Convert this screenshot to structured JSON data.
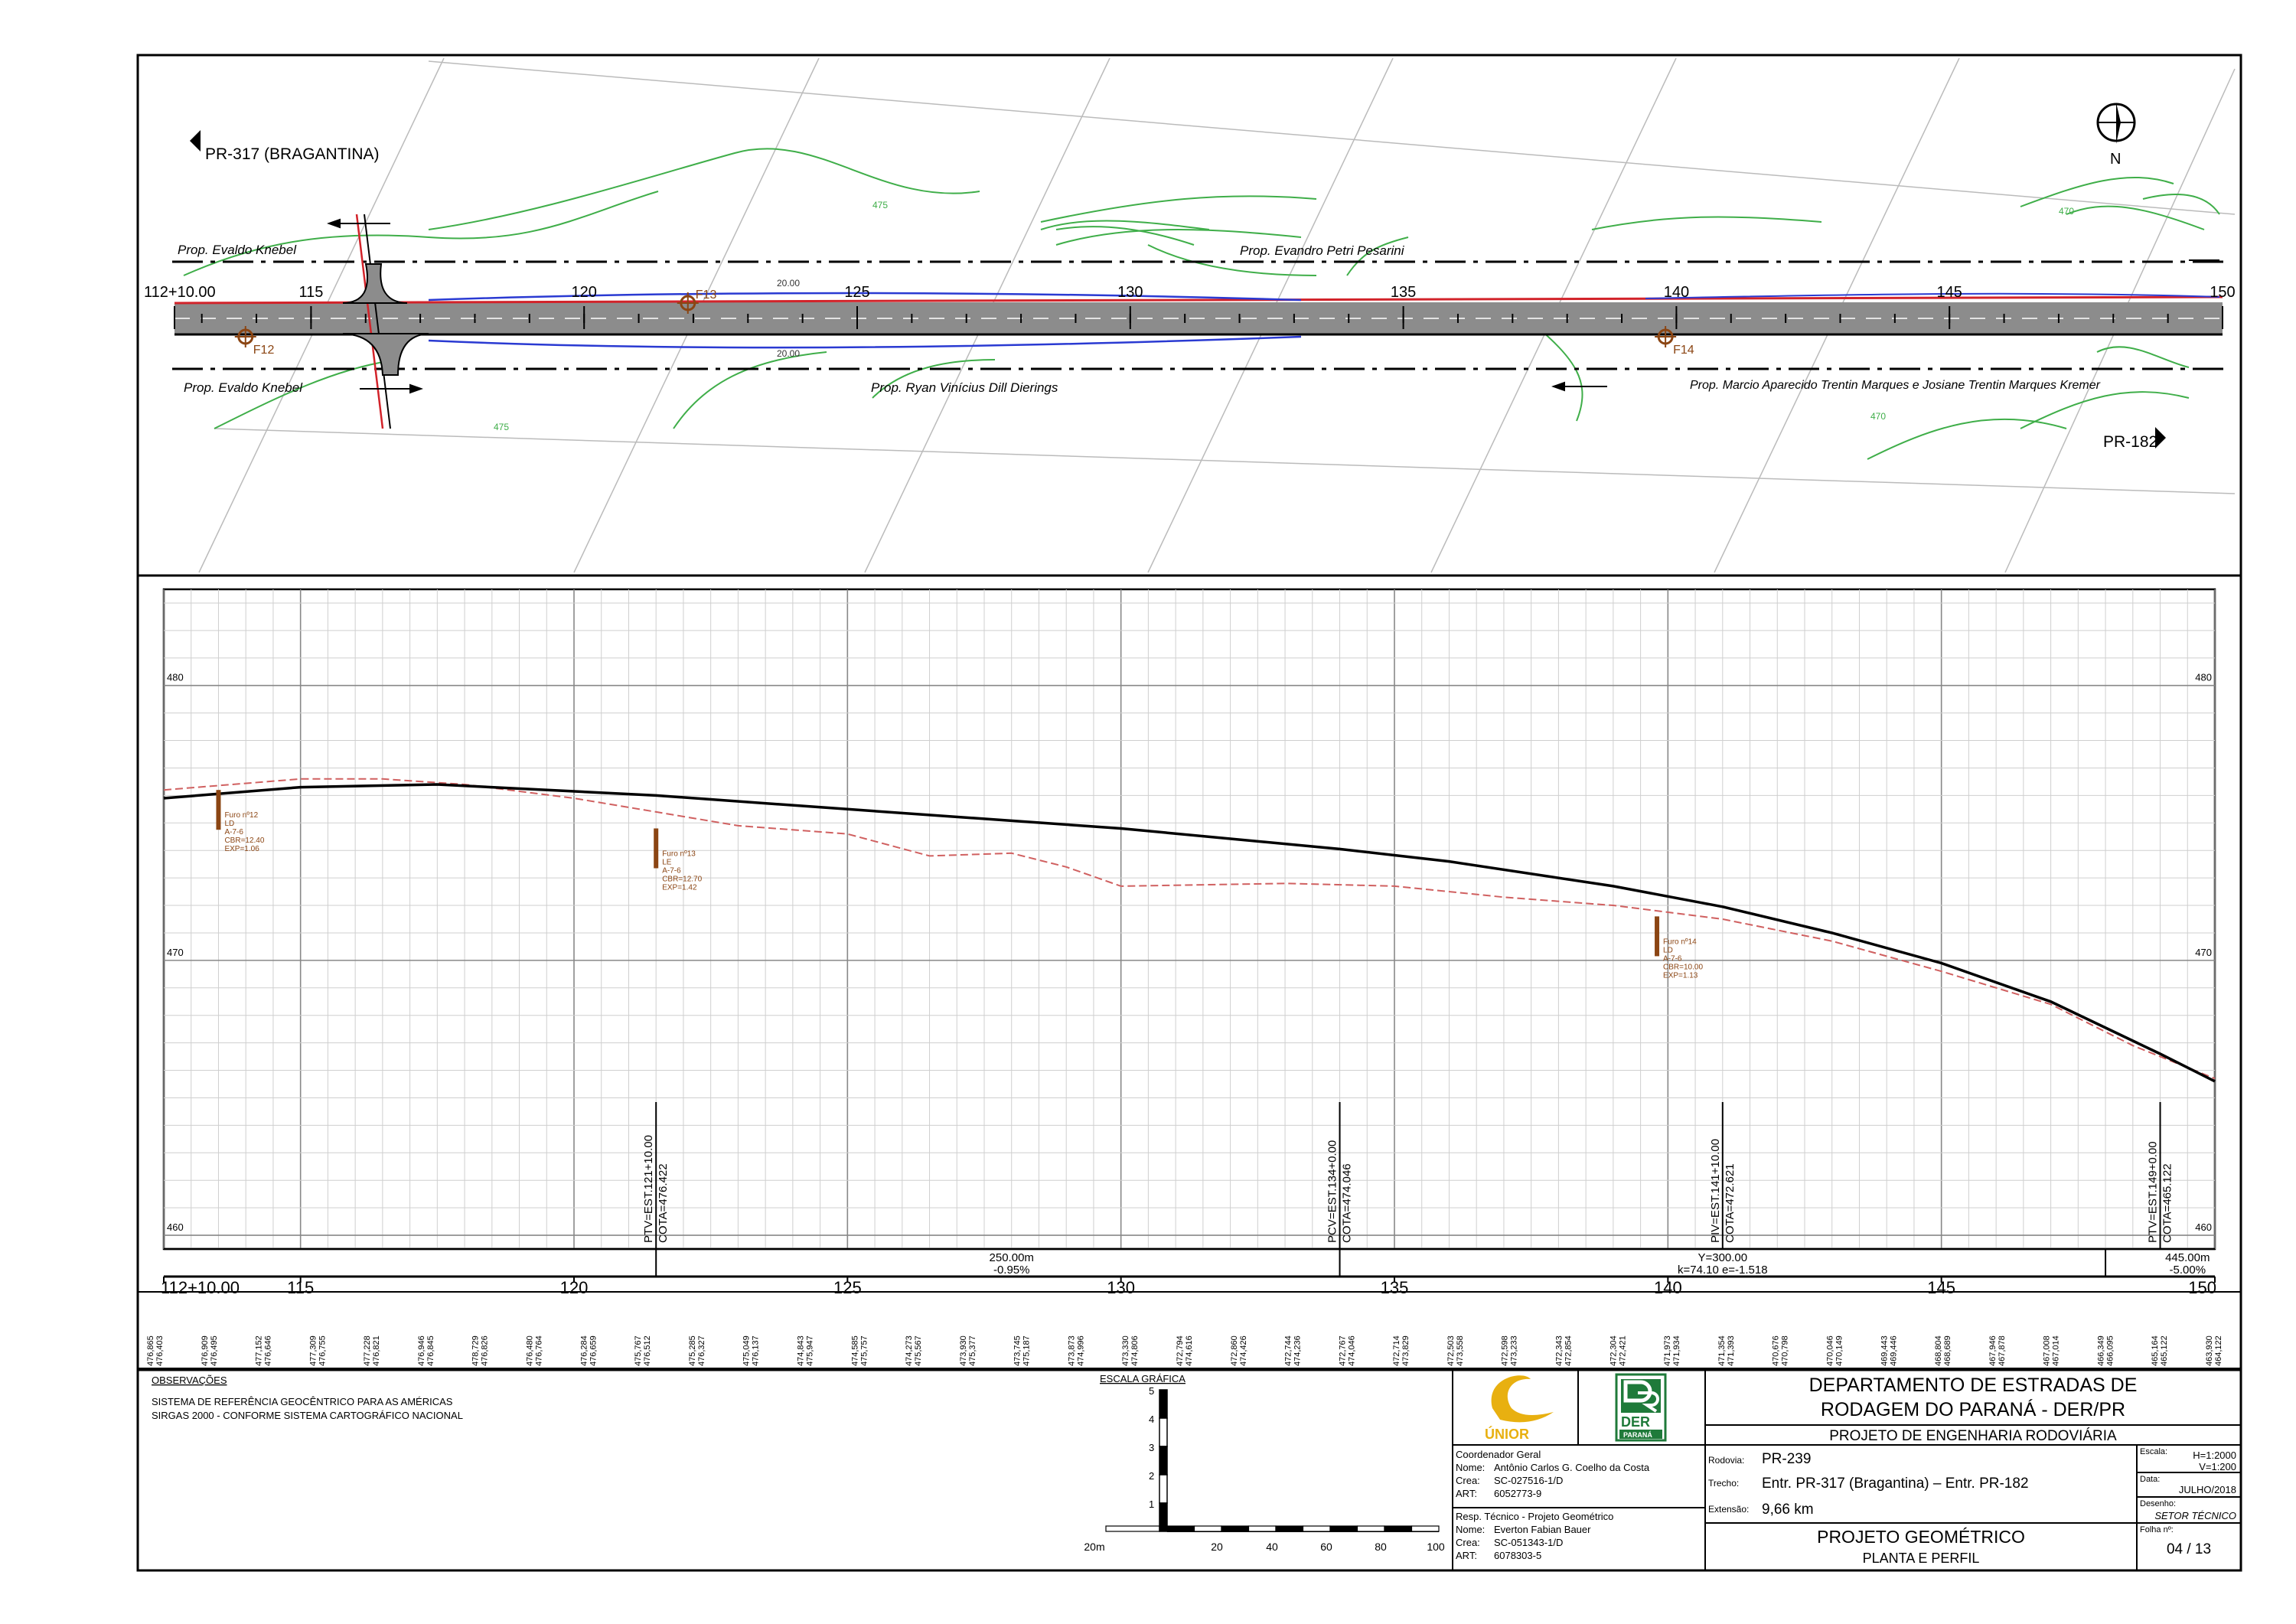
{
  "plan": {
    "road_left": "PR-317 (BRAGANTINA)",
    "road_right": "PR-182",
    "north_label": "N",
    "properties_top": [
      {
        "name": "Prop. Evaldo Knebel"
      },
      {
        "name": "Prop. Evandro Petri Pesarini"
      }
    ],
    "properties_bottom": [
      {
        "name": "Prop. Evaldo Knebel"
      },
      {
        "name": "Prop. Ryan Vinícius Dill Dierings"
      },
      {
        "name": "Prop. Marcio Aparecido Trentin Marques e Josiane Trentin Marques Kremer"
      }
    ],
    "stations": [
      {
        "label": "112+10.00",
        "st": 112.5
      },
      {
        "label": "115",
        "st": 115
      },
      {
        "label": "120",
        "st": 120
      },
      {
        "label": "125",
        "st": 125
      },
      {
        "label": "130",
        "st": 130
      },
      {
        "label": "135",
        "st": 135
      },
      {
        "label": "140",
        "st": 140
      },
      {
        "label": "145",
        "st": 145
      },
      {
        "label": "150",
        "st": 150
      }
    ],
    "boreholes": [
      {
        "label": "F12",
        "st": 113.8,
        "side": "bottom"
      },
      {
        "label": "F13",
        "st": 121.9,
        "side": "top"
      },
      {
        "label": "F14",
        "st": 139.8,
        "side": "bottom"
      }
    ],
    "widths": [
      "20.00",
      "20.00"
    ],
    "contours": [
      "475",
      "470",
      "475",
      "470"
    ]
  },
  "profile": {
    "y_ticks": [
      "480",
      "470",
      "460"
    ],
    "ylim": [
      459.5,
      483.5
    ],
    "xlim": [
      112.5,
      150
    ],
    "grade_line": [
      {
        "st": 112.5,
        "z": 475.9
      },
      {
        "st": 115,
        "z": 476.3
      },
      {
        "st": 117.5,
        "z": 476.4
      },
      {
        "st": 121.5,
        "z": 476.0
      },
      {
        "st": 125,
        "z": 475.5
      },
      {
        "st": 130,
        "z": 474.8
      },
      {
        "st": 134,
        "z": 474.05
      },
      {
        "st": 136,
        "z": 473.6
      },
      {
        "st": 139,
        "z": 472.7
      },
      {
        "st": 141,
        "z": 471.95
      },
      {
        "st": 143,
        "z": 471.0
      },
      {
        "st": 145,
        "z": 469.9
      },
      {
        "st": 147,
        "z": 468.5
      },
      {
        "st": 149,
        "z": 466.6
      },
      {
        "st": 150,
        "z": 465.6
      }
    ],
    "terrain_line": [
      {
        "st": 112.5,
        "z": 476.2
      },
      {
        "st": 115,
        "z": 476.6
      },
      {
        "st": 116.5,
        "z": 476.6
      },
      {
        "st": 118,
        "z": 476.4
      },
      {
        "st": 120,
        "z": 475.9
      },
      {
        "st": 121.5,
        "z": 475.4
      },
      {
        "st": 123,
        "z": 474.9
      },
      {
        "st": 125,
        "z": 474.6
      },
      {
        "st": 126.5,
        "z": 473.8
      },
      {
        "st": 128,
        "z": 473.9
      },
      {
        "st": 129,
        "z": 473.4
      },
      {
        "st": 130,
        "z": 472.7
      },
      {
        "st": 133,
        "z": 472.8
      },
      {
        "st": 135,
        "z": 472.7
      },
      {
        "st": 137,
        "z": 472.3
      },
      {
        "st": 139,
        "z": 472.0
      },
      {
        "st": 141,
        "z": 471.5
      },
      {
        "st": 143,
        "z": 470.7
      },
      {
        "st": 145,
        "z": 469.6
      },
      {
        "st": 147,
        "z": 468.4
      },
      {
        "st": 148.5,
        "z": 466.9
      },
      {
        "st": 150,
        "z": 465.7
      }
    ],
    "pi_labels": [
      {
        "st": 121.5,
        "text": "PTV=EST.121+10.00",
        "cota": "COTA=476.422"
      },
      {
        "st": 134,
        "text": "PCV=EST.134+0.00",
        "cota": "COTA=474.046"
      },
      {
        "st": 141,
        "text": "PIV=EST.141+10.00",
        "cota": "COTA=472.621"
      },
      {
        "st": 149,
        "text": "PTV=EST.149+0.00",
        "cota": "COTA=465.122"
      }
    ],
    "furos": [
      {
        "st": 113.5,
        "z": 476.2,
        "lines": [
          "Furo  nº12",
          "LD",
          "A-7-6",
          "CBR=12.40",
          "EXP=1.06"
        ]
      },
      {
        "st": 121.5,
        "z": 474.8,
        "lines": [
          "Furo  nº13",
          "LE",
          "A-7-6",
          "CBR=12.70",
          "EXP=1.42"
        ]
      },
      {
        "st": 139.8,
        "z": 471.6,
        "lines": [
          "Furo  nº14",
          "LD",
          "A-7-6",
          "CBR=10.00",
          "EXP=1.13"
        ]
      }
    ],
    "segments": [
      {
        "st": 128,
        "l1": "250.00m",
        "l2": "-0.95%"
      },
      {
        "st": 141,
        "l1": "Y=300.00",
        "l2": "k=74.10  e=-1.518"
      },
      {
        "st": 149.5,
        "l1": "445.00m",
        "l2": "-5.00%"
      }
    ],
    "x_ticks": [
      {
        "label": "112+10.00",
        "st": 112.5
      },
      {
        "label": "115",
        "st": 115
      },
      {
        "label": "120",
        "st": 120
      },
      {
        "label": "125",
        "st": 125
      },
      {
        "label": "130",
        "st": 130
      },
      {
        "label": "135",
        "st": 135
      },
      {
        "label": "140",
        "st": 140
      },
      {
        "label": "145",
        "st": 145
      },
      {
        "label": "150",
        "st": 150
      }
    ],
    "elev_pairs": [
      [
        "476,865",
        "476,403"
      ],
      [
        "476,909",
        "476,495"
      ],
      [
        "477,152",
        "476,646"
      ],
      [
        "477,309",
        "476,755"
      ],
      [
        "477,228",
        "476,821"
      ],
      [
        "476,946",
        "476,845"
      ],
      [
        "478,729",
        "476,826"
      ],
      [
        "476,480",
        "476,764"
      ],
      [
        "476,284",
        "476,659"
      ],
      [
        "475,767",
        "476,512"
      ],
      [
        "475,285",
        "476,327"
      ],
      [
        "475,049",
        "476,137"
      ],
      [
        "474,843",
        "475,947"
      ],
      [
        "474,585",
        "475,757"
      ],
      [
        "474,273",
        "475,567"
      ],
      [
        "473,930",
        "475,377"
      ],
      [
        "473,745",
        "475,187"
      ],
      [
        "473,873",
        "474,996"
      ],
      [
        "473,330",
        "474,806"
      ],
      [
        "472,794",
        "474,616"
      ],
      [
        "472,860",
        "474,426"
      ],
      [
        "472,744",
        "474,236"
      ],
      [
        "472,767",
        "474,046"
      ],
      [
        "472,714",
        "473,829"
      ],
      [
        "472,503",
        "473,558"
      ],
      [
        "472,598",
        "473,233"
      ],
      [
        "472,343",
        "472,854"
      ],
      [
        "472,304",
        "472,421"
      ],
      [
        "471,973",
        "471,934"
      ],
      [
        "471,354",
        "471,393"
      ],
      [
        "470,676",
        "470,798"
      ],
      [
        "470,046",
        "470,149"
      ],
      [
        "469,443",
        "469,446"
      ],
      [
        "468,804",
        "468,689"
      ],
      [
        "467,946",
        "467,878"
      ],
      [
        "467,008",
        "467,014"
      ],
      [
        "466,349",
        "466,095"
      ],
      [
        "465,164",
        "465,122"
      ],
      [
        "463,930",
        "464,122"
      ]
    ]
  },
  "notes": {
    "title": "OBSERVAÇÕES",
    "lines": [
      "SISTEMA DE REFERÊNCIA GEOCÊNTRICO PARA AS AMÉRICAS",
      "SIRGAS 2000 - CONFORME SISTEMA CARTOGRÁFICO NACIONAL"
    ]
  },
  "scale": {
    "title": "ESCALA GRÁFICA",
    "v_ticks": [
      "1",
      "2",
      "3",
      "4",
      "5"
    ],
    "h_labels": [
      "20m",
      "20",
      "40",
      "60",
      "80",
      "100"
    ]
  },
  "title_block": {
    "logo_unior": "ÚNIOR",
    "logo_der_top": "DER",
    "logo_der_bottom": "PARANÁ",
    "coord_header": "Coordenador Geral",
    "coord_nome_label": "Nome:",
    "coord_nome": "Antônio Carlos G. Coelho da Costa",
    "coord_crea_label": "Crea:",
    "coord_crea": "SC-027516-1/D",
    "coord_art_label": "ART:",
    "coord_art": "6052773-9",
    "resp_header": "Resp. Técnico  -  Projeto Geométrico",
    "resp_nome_label": "Nome:",
    "resp_nome": "Everton Fabian Bauer",
    "resp_crea_label": "Crea:",
    "resp_crea": "SC-051343-1/D",
    "resp_art_label": "ART:",
    "resp_art": "6078303-5",
    "dept_line1": "DEPARTAMENTO DE ESTRADAS DE",
    "dept_line2": "RODAGEM DO PARANÁ - DER/PR",
    "project_type": "PROJETO DE ENGENHARIA RODOVIÁRIA",
    "rodovia_label": "Rodovia:",
    "rodovia": "PR-239",
    "trecho_label": "Trecho:",
    "trecho": "Entr. PR-317 (Bragantina) – Entr. PR-182",
    "extensao_label": "Extensão:",
    "extensao": "9,66 km",
    "escala_label": "Escala:",
    "escala_h": "H=1:2000",
    "escala_v": "V=1:200",
    "data_label": "Data:",
    "data": "JULHO/2018",
    "desenho_label": "Desenho:",
    "desenho": "SETOR TÉCNICO",
    "folha_label": "Folha nº:",
    "folha": "04 / 13",
    "drawing_title": "PROJETO GEOMÉTRICO",
    "drawing_subtitle": "PLANTA E PERFIL"
  },
  "colors": {
    "road": "#8c8c8c",
    "edge_red": "#d2232a",
    "edge_blue": "#2a3ad2",
    "contour": "#3fae49",
    "furo": "#8b4513",
    "terrain": "#d06060",
    "grid": "#cfcfcf",
    "der_green": "#1f7a3a",
    "unior_yellow": "#e8b010"
  }
}
